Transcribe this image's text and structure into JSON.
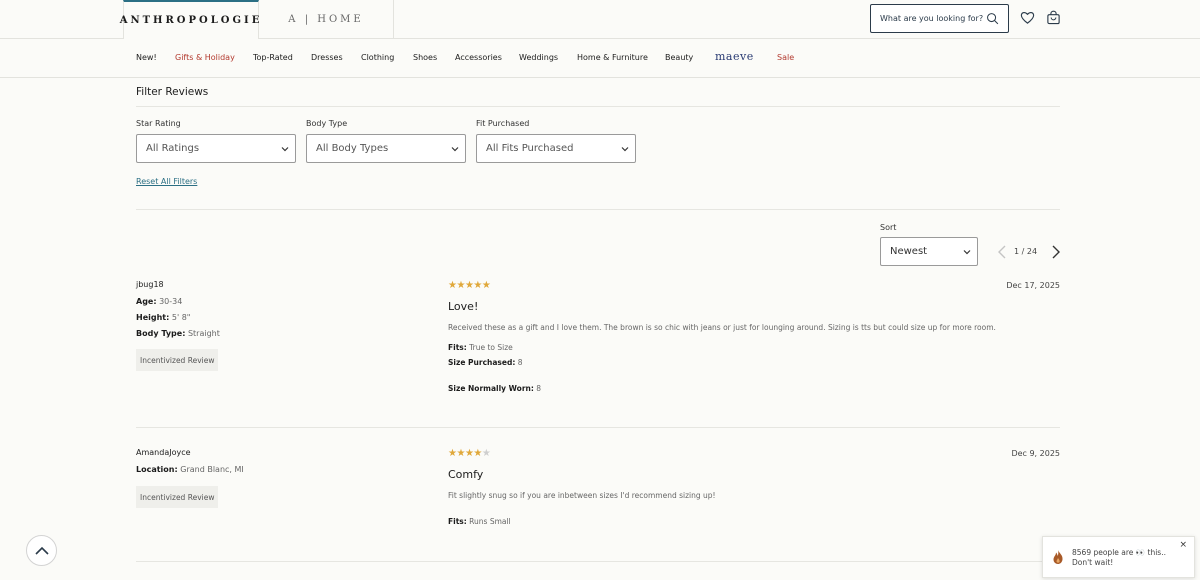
{
  "header": {
    "brand_primary": "ANTHROPOLOGIE",
    "brand_secondary": "A | HOME",
    "search_placeholder": "What are you looking for?",
    "icons": [
      "search-icon",
      "heart-icon",
      "bag-icon"
    ]
  },
  "nav": {
    "items": [
      {
        "label": "New!",
        "color": "#1c1c1c"
      },
      {
        "label": "Gifts & Holiday",
        "color": "#b33a2f"
      },
      {
        "label": "Top-Rated",
        "color": "#1c1c1c"
      },
      {
        "label": "Dresses",
        "color": "#1c1c1c"
      },
      {
        "label": "Clothing",
        "color": "#1c1c1c"
      },
      {
        "label": "Shoes",
        "color": "#1c1c1c"
      },
      {
        "label": "Accessories",
        "color": "#1c1c1c"
      },
      {
        "label": "Weddings",
        "color": "#1c1c1c"
      },
      {
        "label": "Home & Furniture",
        "color": "#1c1c1c"
      },
      {
        "label": "Beauty",
        "color": "#1c1c1c"
      },
      {
        "label": "maeve",
        "color": "#2a3b73"
      },
      {
        "label": "Sale",
        "color": "#b33a2f"
      }
    ]
  },
  "filters": {
    "title": "Filter Reviews",
    "star_rating": {
      "label": "Star Rating",
      "value": "All Ratings"
    },
    "body_type": {
      "label": "Body Type",
      "value": "All Body Types"
    },
    "fit_purchased": {
      "label": "Fit Purchased",
      "value": "All Fits Purchased"
    },
    "reset_label": "Reset All Filters"
  },
  "sort": {
    "label": "Sort",
    "value": "Newest"
  },
  "pagination": {
    "current": "1",
    "separator": "/",
    "total": "24"
  },
  "reviews": [
    {
      "user": "jbug18",
      "attributes": [
        {
          "key": "Age:",
          "value": "30-34"
        },
        {
          "key": "Height:",
          "value": "5' 8\""
        },
        {
          "key": "Body Type:",
          "value": "Straight"
        }
      ],
      "badge": "Incentivized Review",
      "rating": 5,
      "date": "Dec 17, 2025",
      "title": "Love!",
      "body": "Received these as a gift and I love them. The brown is so chic with jeans or just for lounging around. Sizing is tts but could size up for more room.",
      "fits_label": "Fits:",
      "fits_value": "True to Size",
      "size_purchased_label": "Size Purchased:",
      "size_purchased_value": "8",
      "size_worn_label": "Size Normally Worn:",
      "size_worn_value": "8"
    },
    {
      "user": "AmandaJoyce",
      "attributes": [
        {
          "key": "Location:",
          "value": "Grand Blanc, MI"
        }
      ],
      "badge": "Incentivized Review",
      "rating": 4,
      "date": "Dec 9, 2025",
      "title": "Comfy",
      "body": "Fit slightly snug so if you are inbetween sizes I'd recommend sizing up!",
      "fits_label": "Fits:",
      "fits_value": "Runs Small"
    }
  ],
  "toast": {
    "line1": "8569 people are 👀 this..",
    "line2": "Don't wait!",
    "close": "×"
  },
  "colors": {
    "accent": "#2b6f84",
    "sale_red": "#b33a2f",
    "star": "#e0a83a",
    "maeve_blue": "#2a3b73"
  }
}
